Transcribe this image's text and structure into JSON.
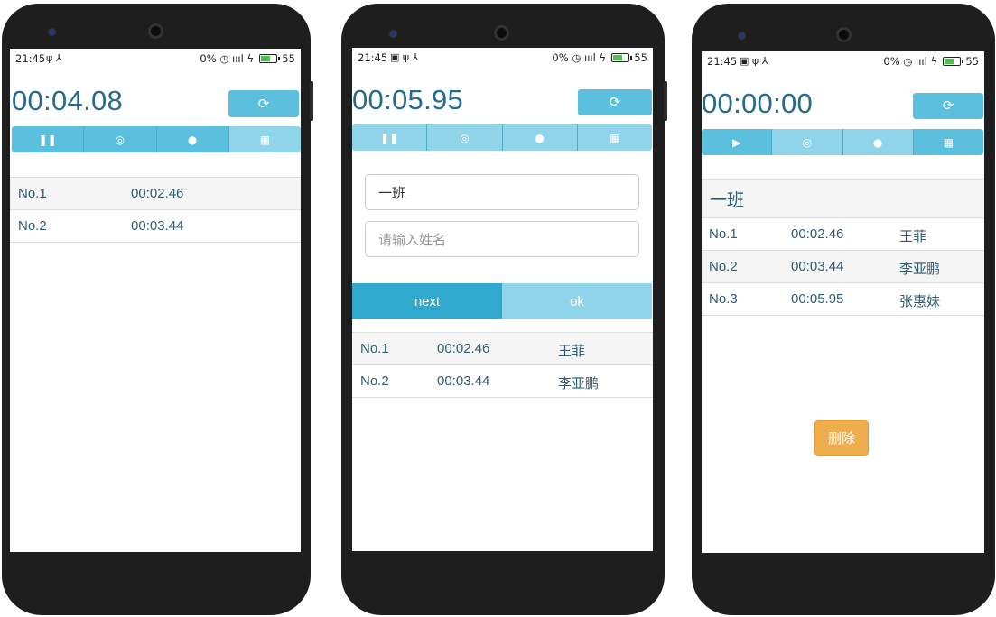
{
  "status_bar": {
    "time": "21:45",
    "left_icons_1": "ψ ⅄",
    "left_icons_2": "▣ ψ ⅄",
    "right_text": "0",
    "battery": "55"
  },
  "icons": {
    "reset": "refresh-icon",
    "pause": "pause-icon",
    "play": "play-icon",
    "check": "check-circle-icon",
    "user": "user-icon",
    "grid": "grid-icon"
  },
  "colors": {
    "primary": "#5bc0de",
    "primary_light": "#8fd4e8",
    "primary_dark": "#31a9cf",
    "timer_text": "#266b8c",
    "warning": "#f0ad4e"
  },
  "screen1": {
    "timer": "00:04.08",
    "rows": [
      {
        "no": "No.1",
        "time": "00:02.46"
      },
      {
        "no": "No.2",
        "time": "00:03.44"
      }
    ]
  },
  "screen2": {
    "timer": "00:05.95",
    "class_input_value": "一班",
    "name_input_placeholder": "请输入姓名",
    "next_label": "next",
    "ok_label": "ok",
    "rows": [
      {
        "no": "No.1",
        "time": "00:02.46",
        "name": "王菲"
      },
      {
        "no": "No.2",
        "time": "00:03.44",
        "name": "李亚鹏"
      }
    ]
  },
  "screen3": {
    "timer": "00:00:00",
    "group_title": "一班",
    "rows": [
      {
        "no": "No.1",
        "time": "00:02.46",
        "name": "王菲"
      },
      {
        "no": "No.2",
        "time": "00:03.44",
        "name": "李亚鹏"
      },
      {
        "no": "No.3",
        "time": "00:05.95",
        "name": "张惠妹"
      }
    ],
    "delete_label": "删除"
  }
}
